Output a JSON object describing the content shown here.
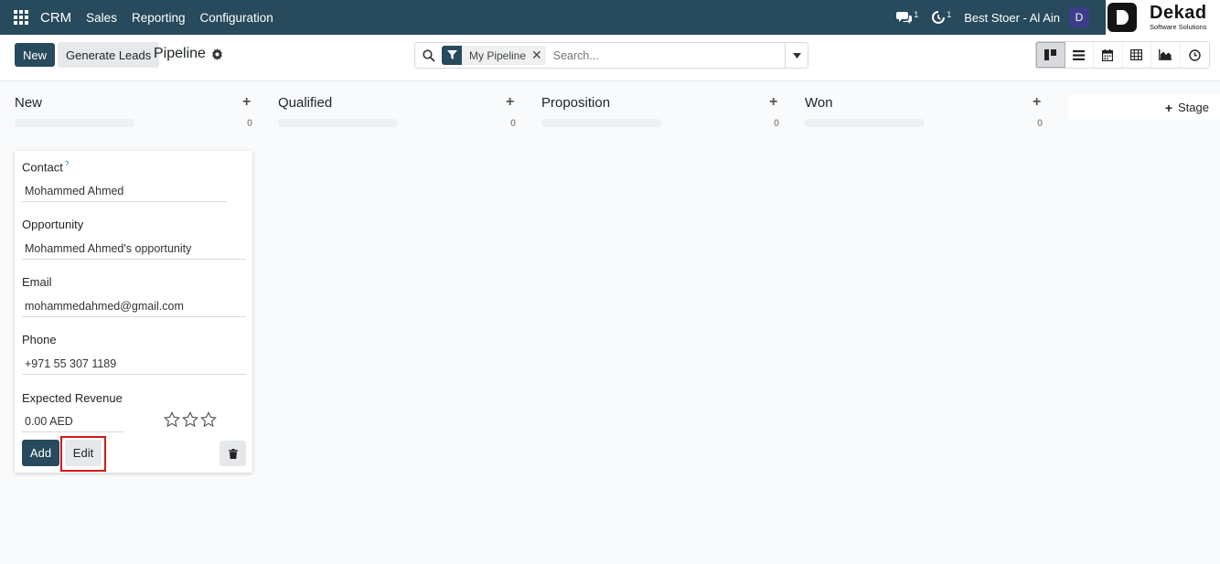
{
  "navbar": {
    "app_name": "CRM",
    "menu": [
      "Sales",
      "Reporting",
      "Configuration"
    ],
    "messages_count": "1",
    "activities_count": "1",
    "company": "Best Stoer - Al Ain",
    "avatar_letter": "D",
    "logo_title": "Dekad",
    "logo_subtitle": "Software Solutions"
  },
  "control": {
    "new_label": "New",
    "generate_label": "Generate Leads",
    "breadcrumb": "Pipeline",
    "search": {
      "facet": "My Pipeline",
      "placeholder": "Search..."
    },
    "views": [
      "kanban-icon",
      "list-icon",
      "calendar-icon",
      "pivot-icon",
      "graph-icon",
      "activity-icon"
    ]
  },
  "kanban": {
    "columns": [
      {
        "title": "New",
        "count": "0"
      },
      {
        "title": "Qualified",
        "count": "0"
      },
      {
        "title": "Proposition",
        "count": "0"
      },
      {
        "title": "Won",
        "count": "0"
      }
    ],
    "add_stage_label": "Stage"
  },
  "quick_create": {
    "contact_label": "Contact",
    "contact_help": "?",
    "contact_value": "Mohammed Ahmed",
    "opportunity_label": "Opportunity",
    "opportunity_value": "Mohammed Ahmed's opportunity",
    "email_label": "Email",
    "email_value": "mohammedahmed@gmail.com",
    "phone_label": "Phone",
    "phone_value": "+971 55 307 1189",
    "revenue_label": "Expected Revenue",
    "revenue_value": "0.00 AED",
    "priority_stars": 0,
    "add_label": "Add",
    "edit_label": "Edit"
  },
  "colors": {
    "primary": "#274a5c",
    "highlight": "#d11c1c"
  }
}
